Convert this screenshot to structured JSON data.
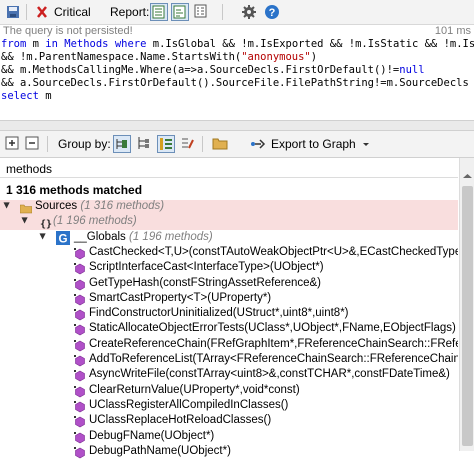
{
  "toolbar": {
    "critical_label": "Critical",
    "report_label": "Report:"
  },
  "status": {
    "left": "The query is not persisted!",
    "right": "101 ms"
  },
  "code_lines": [
    [
      {
        "t": "from",
        "c": "kw"
      },
      {
        "t": " m ",
        "c": ""
      },
      {
        "t": "in",
        "c": "kw"
      },
      {
        "t": " ",
        "c": ""
      },
      {
        "t": "Methods",
        "c": "kw"
      },
      {
        "t": " ",
        "c": ""
      },
      {
        "t": "where",
        "c": "kw"
      },
      {
        "t": " m.IsGlobal && !m.IsExported && !m.IsStatic && !m.Is",
        "c": ""
      }
    ],
    [
      {
        "t": "&& !m.ParentNamespace.Name.StartsWith(",
        "c": ""
      },
      {
        "t": "\"anonymous\"",
        "c": "str"
      },
      {
        "t": ")",
        "c": ""
      }
    ],
    [
      {
        "t": "&& m.MethodsCallingMe.Where(a=>a.SourceDecls.FirstOrDefault()!=",
        "c": ""
      },
      {
        "t": "null",
        "c": "kw"
      }
    ],
    [
      {
        "t": "&& a.SourceDecls.FirstOrDefault().SourceFile.FilePathString!=m.SourceDecls",
        "c": ""
      }
    ],
    [
      {
        "t": "select",
        "c": "kw"
      },
      {
        "t": " m",
        "c": ""
      }
    ]
  ],
  "results_toolbar": {
    "group_by_label": "Group by:",
    "export_label": "Export to Graph"
  },
  "results": {
    "column_label": "methods",
    "summary": "1 316 methods matched"
  },
  "tree": [
    {
      "label": "Sources",
      "count": "(1 316 methods)",
      "indent": 0,
      "kind": "folder",
      "pink": true,
      "expand": "▲"
    },
    {
      "label": "",
      "count": "(1 196 methods)",
      "indent": 1,
      "kind": "braces",
      "pink": true,
      "expand": "▲"
    },
    {
      "label": "__Globals",
      "count": "(1 196 methods)",
      "indent": 2,
      "kind": "class",
      "pink": false,
      "expand": "▲"
    },
    {
      "label": "CastChecked<T,U>(constTAutoWeakObjectPtr<U>&,ECastCheckedType::Type)",
      "count": "",
      "indent": 3,
      "kind": "method",
      "pink": false
    },
    {
      "label": "ScriptInterfaceCast<InterfaceType>(UObject*)",
      "count": "",
      "indent": 3,
      "kind": "method",
      "pink": false
    },
    {
      "label": "GetTypeHash(constFStringAssetReference&)",
      "count": "",
      "indent": 3,
      "kind": "method",
      "pink": false
    },
    {
      "label": "SmartCastProperty<T>(UProperty*)",
      "count": "",
      "indent": 3,
      "kind": "method",
      "pink": false
    },
    {
      "label": "FindConstructorUninitialized(UStruct*,uint8*,uint8*)",
      "count": "",
      "indent": 3,
      "kind": "method",
      "pink": false
    },
    {
      "label": "StaticAllocateObjectErrorTests(UClass*,UObject*,FName,EObjectFlags)",
      "count": "",
      "indent": 3,
      "kind": "method",
      "pink": false
    },
    {
      "label": "CreateReferenceChain(FRefGraphItem*,FReferenceChainSearch::FReferenceCha",
      "count": "",
      "indent": 3,
      "kind": "method",
      "pink": false
    },
    {
      "label": "AddToReferenceList(TArray<FReferenceChainSearch::FReferenceChainLink>&,",
      "count": "",
      "indent": 3,
      "kind": "method",
      "pink": false
    },
    {
      "label": "AsyncWriteFile(constTArray<uint8>&,constTCHAR*,constFDateTime&)",
      "count": "",
      "indent": 3,
      "kind": "method",
      "pink": false
    },
    {
      "label": "ClearReturnValue(UProperty*,void*const)",
      "count": "",
      "indent": 3,
      "kind": "method",
      "pink": false
    },
    {
      "label": "UClassRegisterAllCompiledInClasses()",
      "count": "",
      "indent": 3,
      "kind": "method",
      "pink": false
    },
    {
      "label": "UClassReplaceHotReloadClasses()",
      "count": "",
      "indent": 3,
      "kind": "method",
      "pink": false
    },
    {
      "label": "DebugFName(UObject*)",
      "count": "",
      "indent": 3,
      "kind": "method",
      "pink": false
    },
    {
      "label": "DebugPathName(UObject*)",
      "count": "",
      "indent": 3,
      "kind": "method",
      "pink": false
    }
  ]
}
